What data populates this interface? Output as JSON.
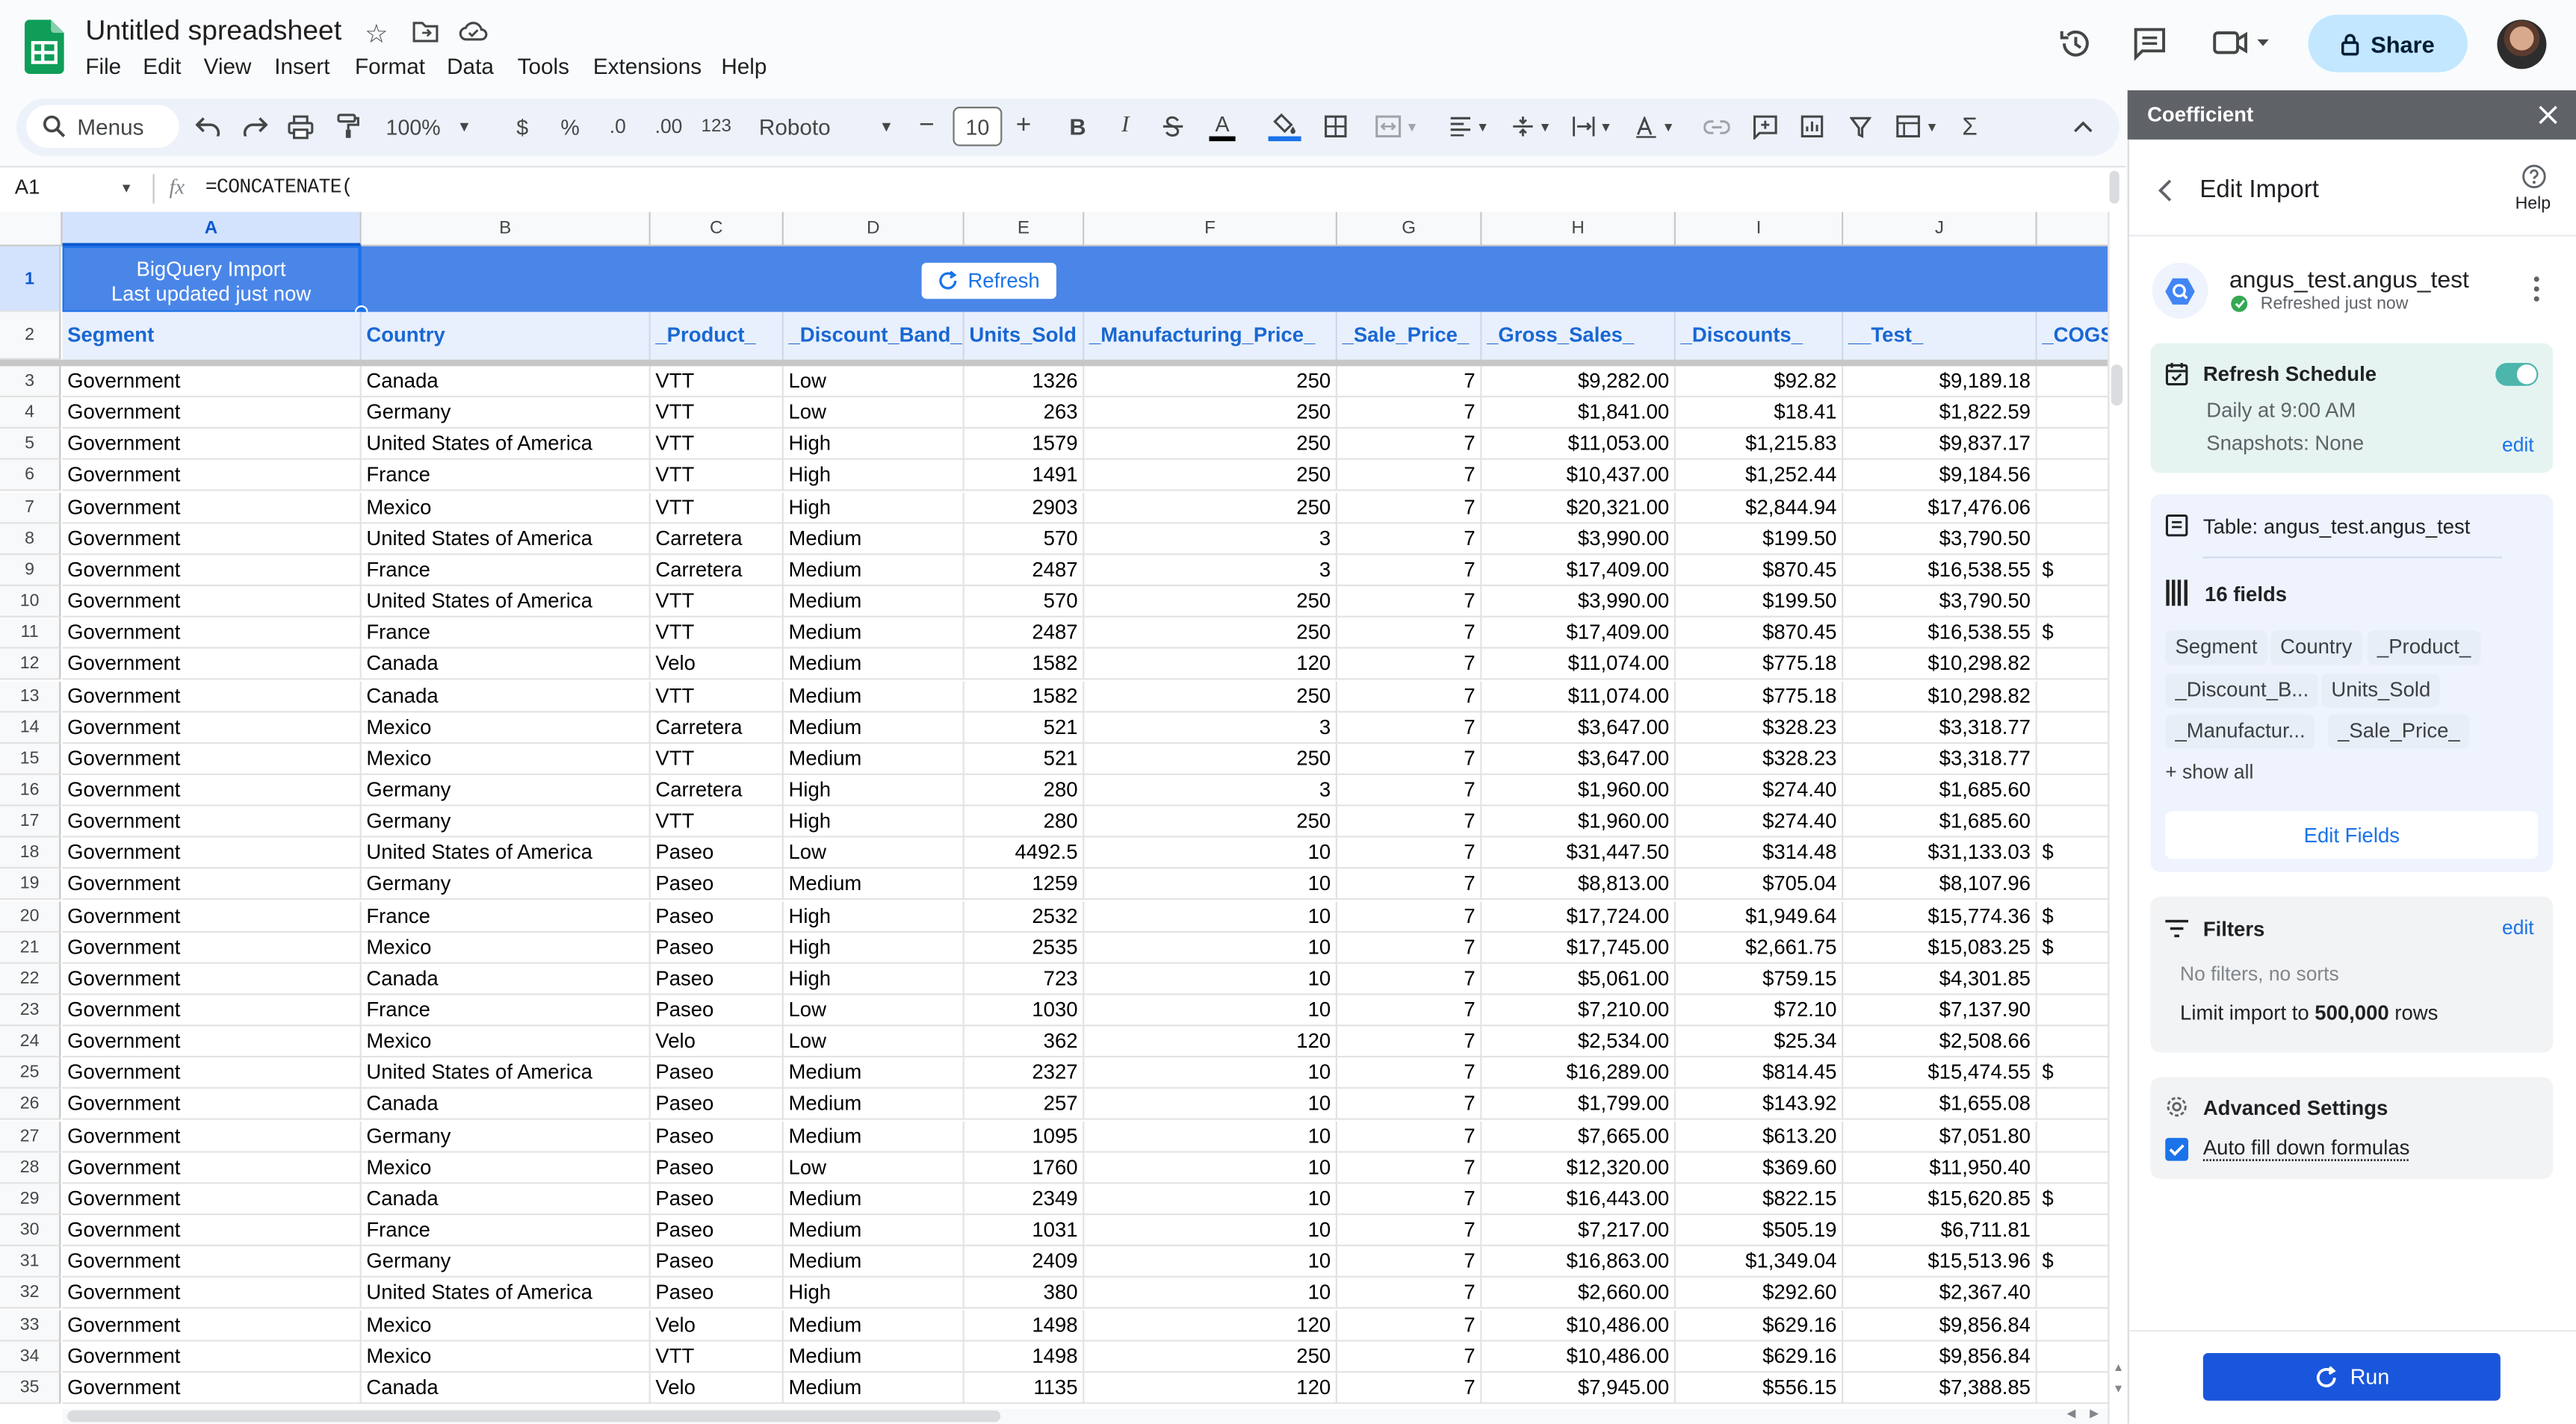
{
  "app": {
    "doc_title": "Untitled spreadsheet",
    "menus": [
      "File",
      "Edit",
      "View",
      "Insert",
      "Format",
      "Data",
      "Tools",
      "Extensions",
      "Help"
    ],
    "share_label": "Share"
  },
  "toolbar": {
    "menus_label": "Menus",
    "zoom": "100%",
    "currency": "$",
    "percent": "%",
    "dec_decrease": ".0",
    "dec_increase": ".00",
    "format_123": "123",
    "font": "Roboto",
    "font_size": "10",
    "bold": "B",
    "italic": "I",
    "text_color": "A"
  },
  "formula_bar": {
    "cell_ref": "A1",
    "formula": "=CONCATENATE("
  },
  "sheet": {
    "columns": [
      "A",
      "B",
      "C",
      "D",
      "E",
      "F",
      "G",
      "H",
      "I",
      "J"
    ],
    "banner_title": "BigQuery Import",
    "banner_subtitle": "Last updated just now",
    "refresh_label": "Refresh",
    "headers": [
      "Segment",
      "Country",
      "_Product_",
      "_Discount_Band_",
      "Units_Sold",
      "_Manufacturing_Price_",
      "_Sale_Price_",
      "_Gross_Sales_",
      "_Discounts_",
      "__Test_",
      "_COGS_"
    ],
    "rows": [
      [
        "Government",
        "Canada",
        "VTT",
        "Low",
        "1326",
        "250",
        "7",
        "$9,282.00",
        "$92.82",
        "$9,189.18"
      ],
      [
        "Government",
        "Germany",
        "VTT",
        "Low",
        "263",
        "250",
        "7",
        "$1,841.00",
        "$18.41",
        "$1,822.59"
      ],
      [
        "Government",
        "United States of America",
        "VTT",
        "High",
        "1579",
        "250",
        "7",
        "$11,053.00",
        "$1,215.83",
        "$9,837.17"
      ],
      [
        "Government",
        "France",
        "VTT",
        "High",
        "1491",
        "250",
        "7",
        "$10,437.00",
        "$1,252.44",
        "$9,184.56"
      ],
      [
        "Government",
        "Mexico",
        "VTT",
        "High",
        "2903",
        "250",
        "7",
        "$20,321.00",
        "$2,844.94",
        "$17,476.06"
      ],
      [
        "Government",
        "United States of America",
        "Carretera",
        "Medium",
        "570",
        "3",
        "7",
        "$3,990.00",
        "$199.50",
        "$3,790.50"
      ],
      [
        "Government",
        "France",
        "Carretera",
        "Medium",
        "2487",
        "3",
        "7",
        "$17,409.00",
        "$870.45",
        "$16,538.55"
      ],
      [
        "Government",
        "United States of America",
        "VTT",
        "Medium",
        "570",
        "250",
        "7",
        "$3,990.00",
        "$199.50",
        "$3,790.50"
      ],
      [
        "Government",
        "France",
        "VTT",
        "Medium",
        "2487",
        "250",
        "7",
        "$17,409.00",
        "$870.45",
        "$16,538.55"
      ],
      [
        "Government",
        "Canada",
        "Velo",
        "Medium",
        "1582",
        "120",
        "7",
        "$11,074.00",
        "$775.18",
        "$10,298.82"
      ],
      [
        "Government",
        "Canada",
        "VTT",
        "Medium",
        "1582",
        "250",
        "7",
        "$11,074.00",
        "$775.18",
        "$10,298.82"
      ],
      [
        "Government",
        "Mexico",
        "Carretera",
        "Medium",
        "521",
        "3",
        "7",
        "$3,647.00",
        "$328.23",
        "$3,318.77"
      ],
      [
        "Government",
        "Mexico",
        "VTT",
        "Medium",
        "521",
        "250",
        "7",
        "$3,647.00",
        "$328.23",
        "$3,318.77"
      ],
      [
        "Government",
        "Germany",
        "Carretera",
        "High",
        "280",
        "3",
        "7",
        "$1,960.00",
        "$274.40",
        "$1,685.60"
      ],
      [
        "Government",
        "Germany",
        "VTT",
        "High",
        "280",
        "250",
        "7",
        "$1,960.00",
        "$274.40",
        "$1,685.60"
      ],
      [
        "Government",
        "United States of America",
        "Paseo",
        "Low",
        "4492.5",
        "10",
        "7",
        "$31,447.50",
        "$314.48",
        "$31,133.03"
      ],
      [
        "Government",
        "Germany",
        "Paseo",
        "Medium",
        "1259",
        "10",
        "7",
        "$8,813.00",
        "$705.04",
        "$8,107.96"
      ],
      [
        "Government",
        "France",
        "Paseo",
        "High",
        "2532",
        "10",
        "7",
        "$17,724.00",
        "$1,949.64",
        "$15,774.36"
      ],
      [
        "Government",
        "Mexico",
        "Paseo",
        "High",
        "2535",
        "10",
        "7",
        "$17,745.00",
        "$2,661.75",
        "$15,083.25"
      ],
      [
        "Government",
        "Canada",
        "Paseo",
        "High",
        "723",
        "10",
        "7",
        "$5,061.00",
        "$759.15",
        "$4,301.85"
      ],
      [
        "Government",
        "France",
        "Paseo",
        "Low",
        "1030",
        "10",
        "7",
        "$7,210.00",
        "$72.10",
        "$7,137.90"
      ],
      [
        "Government",
        "Mexico",
        "Velo",
        "Low",
        "362",
        "120",
        "7",
        "$2,534.00",
        "$25.34",
        "$2,508.66"
      ],
      [
        "Government",
        "United States of America",
        "Paseo",
        "Medium",
        "2327",
        "10",
        "7",
        "$16,289.00",
        "$814.45",
        "$15,474.55"
      ],
      [
        "Government",
        "Canada",
        "Paseo",
        "Medium",
        "257",
        "10",
        "7",
        "$1,799.00",
        "$143.92",
        "$1,655.08"
      ],
      [
        "Government",
        "Germany",
        "Paseo",
        "Medium",
        "1095",
        "10",
        "7",
        "$7,665.00",
        "$613.20",
        "$7,051.80"
      ],
      [
        "Government",
        "Mexico",
        "Paseo",
        "Low",
        "1760",
        "10",
        "7",
        "$12,320.00",
        "$369.60",
        "$11,950.40"
      ],
      [
        "Government",
        "Canada",
        "Paseo",
        "Medium",
        "2349",
        "10",
        "7",
        "$16,443.00",
        "$822.15",
        "$15,620.85"
      ],
      [
        "Government",
        "France",
        "Paseo",
        "Medium",
        "1031",
        "10",
        "7",
        "$7,217.00",
        "$505.19",
        "$6,711.81"
      ],
      [
        "Government",
        "Germany",
        "Paseo",
        "Medium",
        "2409",
        "10",
        "7",
        "$16,863.00",
        "$1,349.04",
        "$15,513.96"
      ],
      [
        "Government",
        "United States of America",
        "Paseo",
        "High",
        "380",
        "10",
        "7",
        "$2,660.00",
        "$292.60",
        "$2,367.40"
      ],
      [
        "Government",
        "Mexico",
        "Velo",
        "Medium",
        "1498",
        "120",
        "7",
        "$10,486.00",
        "$629.16",
        "$9,856.84"
      ],
      [
        "Government",
        "Mexico",
        "VTT",
        "Medium",
        "1498",
        "250",
        "7",
        "$10,486.00",
        "$629.16",
        "$9,856.84"
      ],
      [
        "Government",
        "Canada",
        "Velo",
        "Medium",
        "1135",
        "120",
        "7",
        "$7,945.00",
        "$556.15",
        "$7,388.85"
      ]
    ],
    "row_numbers": [
      "1",
      "2",
      "3",
      "4",
      "5",
      "6",
      "7",
      "8",
      "9",
      "10",
      "11",
      "12",
      "13",
      "14",
      "15",
      "16",
      "17",
      "18",
      "19",
      "20",
      "21",
      "22",
      "23",
      "24",
      "25",
      "26",
      "27",
      "28",
      "29",
      "30",
      "31",
      "32",
      "33",
      "34",
      "35"
    ],
    "overflow_marks": [
      "",
      "",
      "",
      "",
      "",
      "",
      "$",
      "",
      "$",
      "",
      "",
      "",
      "",
      "",
      "",
      "$",
      "",
      "$",
      "$",
      "",
      "",
      "",
      "$",
      "",
      "",
      "",
      "$",
      "",
      "$",
      "",
      "",
      "",
      ""
    ]
  },
  "panel": {
    "title": "Coefficient",
    "section_title": "Edit Import",
    "help_label": "Help",
    "source_name": "angus_test.angus_test",
    "source_status": "Refreshed just now",
    "schedule": {
      "title": "Refresh Schedule",
      "line1": "Daily at 9:00 AM",
      "line2": "Snapshots: None",
      "edit": "edit",
      "enabled": true
    },
    "table_label": "Table: angus_test.angus_test",
    "fields_count": "16 fields",
    "fields": [
      "Segment",
      "Country",
      "_Product_",
      "_Discount_B...",
      "Units_Sold",
      "_Manufactur...",
      "_Sale_Price_"
    ],
    "show_all": "+ show all",
    "edit_fields": "Edit Fields",
    "filters": {
      "title": "Filters",
      "edit": "edit",
      "none": "No filters, no sorts",
      "limit_prefix": "Limit import to ",
      "limit_value": "500,000",
      "limit_suffix": " rows"
    },
    "advanced": {
      "title": "Advanced Settings",
      "autofill": "Auto fill down formulas",
      "autofill_checked": true
    },
    "run_label": "Run"
  },
  "colors": {
    "accent_blue": "#1a73e8",
    "banner_blue": "#4a86e8",
    "sheets_green": "#0f9d58",
    "run_button": "#1a56db",
    "panel_header": "#5f6368",
    "schedule_bg": "#e6f4f1",
    "toggle_teal": "#4db6ac"
  }
}
